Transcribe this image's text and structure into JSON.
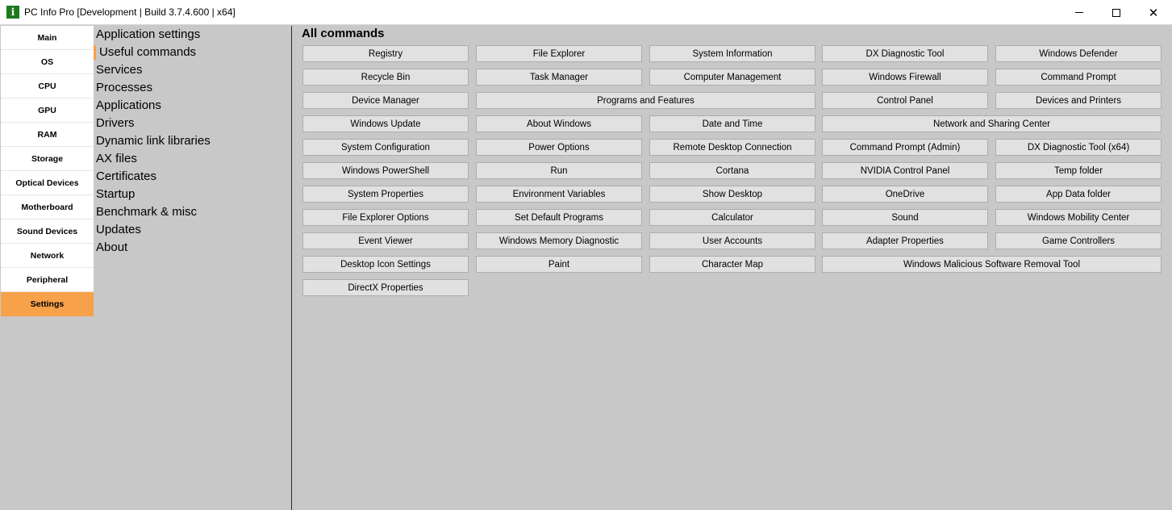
{
  "window": {
    "title": "PC Info Pro [Development | Build 3.7.4.600 | x64]",
    "app_icon_letter": "i",
    "close_glyph": "✕"
  },
  "left_nav": [
    {
      "label": "Main",
      "active": false
    },
    {
      "label": "OS",
      "active": false
    },
    {
      "label": "CPU",
      "active": false
    },
    {
      "label": "GPU",
      "active": false
    },
    {
      "label": "RAM",
      "active": false
    },
    {
      "label": "Storage",
      "active": false
    },
    {
      "label": "Optical Devices",
      "active": false
    },
    {
      "label": "Motherboard",
      "active": false
    },
    {
      "label": "Sound Devices",
      "active": false
    },
    {
      "label": "Network",
      "active": false
    },
    {
      "label": "Peripheral",
      "active": false
    },
    {
      "label": "Settings",
      "active": true
    }
  ],
  "settings_list": [
    {
      "label": "Application settings",
      "active": false
    },
    {
      "label": "Useful commands",
      "active": true
    },
    {
      "label": "Services",
      "active": false
    },
    {
      "label": "Processes",
      "active": false
    },
    {
      "label": "Applications",
      "active": false
    },
    {
      "label": "Drivers",
      "active": false
    },
    {
      "label": "Dynamic link libraries",
      "active": false
    },
    {
      "label": "AX files",
      "active": false
    },
    {
      "label": "Certificates",
      "active": false
    },
    {
      "label": "Startup",
      "active": false
    },
    {
      "label": "Benchmark & misc",
      "active": false
    },
    {
      "label": "Updates",
      "active": false
    },
    {
      "label": "About",
      "active": false
    }
  ],
  "main": {
    "title": "All commands",
    "commands": [
      {
        "label": "Registry",
        "row": 0,
        "col": 0,
        "span": 1
      },
      {
        "label": "File Explorer",
        "row": 0,
        "col": 1,
        "span": 1
      },
      {
        "label": "System Information",
        "row": 0,
        "col": 2,
        "span": 1
      },
      {
        "label": "DX Diagnostic Tool",
        "row": 0,
        "col": 3,
        "span": 1
      },
      {
        "label": "Windows Defender",
        "row": 0,
        "col": 4,
        "span": 1
      },
      {
        "label": "Recycle Bin",
        "row": 1,
        "col": 0,
        "span": 1
      },
      {
        "label": "Task Manager",
        "row": 1,
        "col": 1,
        "span": 1
      },
      {
        "label": "Computer Management",
        "row": 1,
        "col": 2,
        "span": 1
      },
      {
        "label": "Windows Firewall",
        "row": 1,
        "col": 3,
        "span": 1
      },
      {
        "label": "Command Prompt",
        "row": 1,
        "col": 4,
        "span": 1
      },
      {
        "label": "Device Manager",
        "row": 2,
        "col": 0,
        "span": 1
      },
      {
        "label": "Programs and Features",
        "row": 2,
        "col": 1,
        "span": 2
      },
      {
        "label": "Control Panel",
        "row": 2,
        "col": 3,
        "span": 1
      },
      {
        "label": "Devices and Printers",
        "row": 2,
        "col": 4,
        "span": 1
      },
      {
        "label": "Windows Update",
        "row": 3,
        "col": 0,
        "span": 1
      },
      {
        "label": "About Windows",
        "row": 3,
        "col": 1,
        "span": 1
      },
      {
        "label": "Date and Time",
        "row": 3,
        "col": 2,
        "span": 1
      },
      {
        "label": "Network and Sharing Center",
        "row": 3,
        "col": 3,
        "span": 2
      },
      {
        "label": "System Configuration",
        "row": 4,
        "col": 0,
        "span": 1
      },
      {
        "label": "Power Options",
        "row": 4,
        "col": 1,
        "span": 1
      },
      {
        "label": "Remote Desktop Connection",
        "row": 4,
        "col": 2,
        "span": 1
      },
      {
        "label": "Command Prompt (Admin)",
        "row": 4,
        "col": 3,
        "span": 1
      },
      {
        "label": "DX Diagnostic Tool (x64)",
        "row": 4,
        "col": 4,
        "span": 1
      },
      {
        "label": "Windows PowerShell",
        "row": 5,
        "col": 0,
        "span": 1
      },
      {
        "label": "Run",
        "row": 5,
        "col": 1,
        "span": 1
      },
      {
        "label": "Cortana",
        "row": 5,
        "col": 2,
        "span": 1
      },
      {
        "label": "NVIDIA Control Panel",
        "row": 5,
        "col": 3,
        "span": 1
      },
      {
        "label": "Temp folder",
        "row": 5,
        "col": 4,
        "span": 1
      },
      {
        "label": "System Properties",
        "row": 6,
        "col": 0,
        "span": 1
      },
      {
        "label": "Environment Variables",
        "row": 6,
        "col": 1,
        "span": 1
      },
      {
        "label": "Show Desktop",
        "row": 6,
        "col": 2,
        "span": 1
      },
      {
        "label": "OneDrive",
        "row": 6,
        "col": 3,
        "span": 1
      },
      {
        "label": "App Data folder",
        "row": 6,
        "col": 4,
        "span": 1
      },
      {
        "label": "File Explorer Options",
        "row": 7,
        "col": 0,
        "span": 1
      },
      {
        "label": "Set Default Programs",
        "row": 7,
        "col": 1,
        "span": 1
      },
      {
        "label": "Calculator",
        "row": 7,
        "col": 2,
        "span": 1
      },
      {
        "label": "Sound",
        "row": 7,
        "col": 3,
        "span": 1
      },
      {
        "label": "Windows Mobility Center",
        "row": 7,
        "col": 4,
        "span": 1
      },
      {
        "label": "Event Viewer",
        "row": 8,
        "col": 0,
        "span": 1
      },
      {
        "label": "Windows Memory Diagnostic",
        "row": 8,
        "col": 1,
        "span": 1
      },
      {
        "label": "User Accounts",
        "row": 8,
        "col": 2,
        "span": 1
      },
      {
        "label": "Adapter Properties",
        "row": 8,
        "col": 3,
        "span": 1
      },
      {
        "label": "Game Controllers",
        "row": 8,
        "col": 4,
        "span": 1
      },
      {
        "label": "Desktop Icon Settings",
        "row": 9,
        "col": 0,
        "span": 1
      },
      {
        "label": "Paint",
        "row": 9,
        "col": 1,
        "span": 1
      },
      {
        "label": "Character Map",
        "row": 9,
        "col": 2,
        "span": 1
      },
      {
        "label": "Windows Malicious Software Removal Tool",
        "row": 9,
        "col": 3,
        "span": 2
      },
      {
        "label": "DirectX Properties",
        "row": 10,
        "col": 0,
        "span": 1
      }
    ]
  },
  "colors": {
    "accent": "#f7a14a",
    "background": "#c8c8c8",
    "button_face": "#e1e1e1"
  }
}
